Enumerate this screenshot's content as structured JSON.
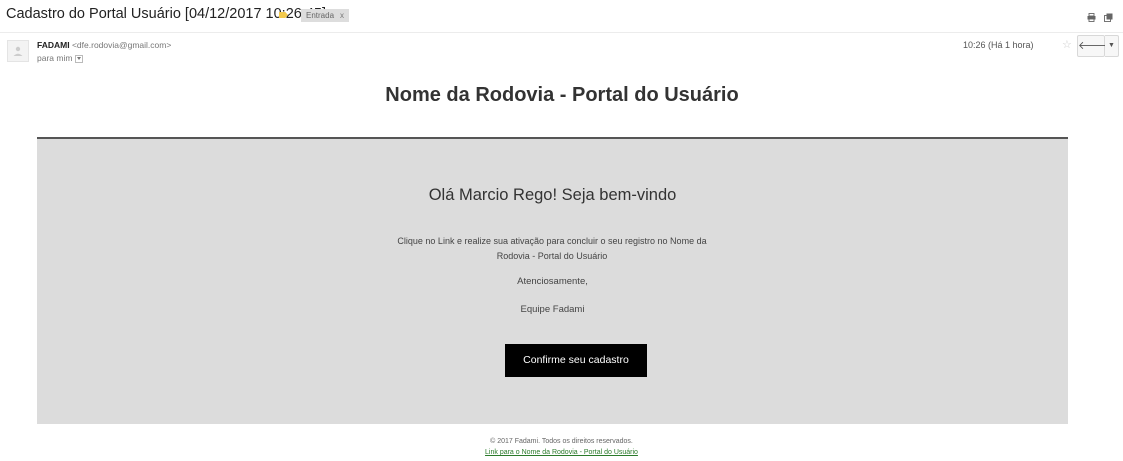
{
  "header": {
    "subject": "Cadastro do Portal Usuário [04/12/2017 10:26:45]",
    "inbox_label": "Entrada",
    "inbox_remove": "x"
  },
  "sender": {
    "name": "FADAMI",
    "email": "<dfe.rodovia@gmail.com>",
    "to": "para mim",
    "time": "10:26 (Há 1 hora)"
  },
  "email": {
    "title": "Nome da Rodovia - Portal do Usuário",
    "greeting": "Olá Marcio Rego! Seja bem-vindo",
    "body": "Clique no Link e realize sua ativação para concluir o seu registro no Nome da Rodovia - Portal do Usuário",
    "regards": "Atenciosamente,",
    "team": "Equipe Fadami",
    "confirm_label": "Confirme seu cadastro",
    "footer_copy": "© 2017 Fadami. Todos os direitos reservados.",
    "footer_link": "Link para o Nome da Rodovia - Portal do Usuário"
  },
  "colors": {
    "panel": "#dcdcdc",
    "button": "#000000",
    "link": "#2a7a2a",
    "label_tag": "#f2c94c"
  }
}
